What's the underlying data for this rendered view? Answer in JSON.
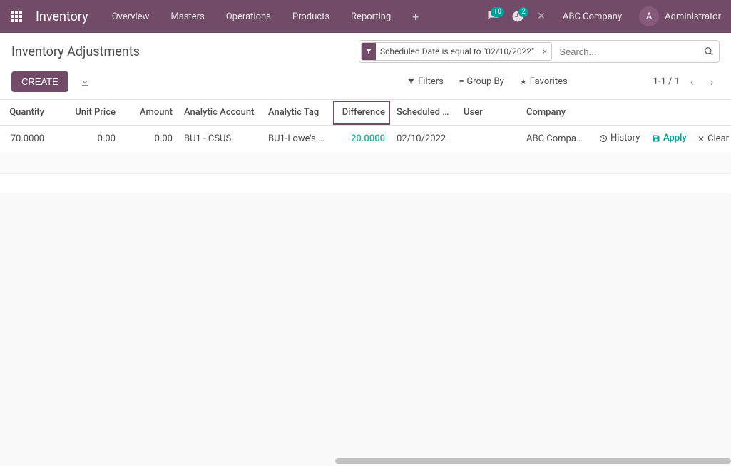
{
  "nav": {
    "brand": "Inventory",
    "items": [
      "Overview",
      "Masters",
      "Operations",
      "Products",
      "Reporting"
    ],
    "messages_badge": "10",
    "activities_badge": "2",
    "company": "ABC Company",
    "avatar_initial": "A",
    "user": "Administrator"
  },
  "cp": {
    "title": "Inventory Adjustments",
    "filter_facet": "Scheduled Date is equal to \"02/10/2022\"",
    "search_placeholder": "Search...",
    "create_label": "CREATE",
    "filters_label": "Filters",
    "groupby_label": "Group By",
    "favorites_label": "Favorites",
    "pager": "1-1 / 1"
  },
  "columns": {
    "quantity": "Quantity",
    "unit_price": "Unit Price",
    "amount": "Amount",
    "analytic_account": "Analytic Account",
    "analytic_tag": "Analytic Tag",
    "difference": "Difference",
    "scheduled": "Scheduled …",
    "user": "User",
    "company": "Company"
  },
  "row": {
    "quantity": "70.0000",
    "unit_price": "0.00",
    "amount": "0.00",
    "analytic_account": "BU1 - CSUS",
    "analytic_tag": "BU1-Lowe's …",
    "difference": "20.0000",
    "scheduled": "02/10/2022",
    "user": "",
    "company": "ABC Compa…"
  },
  "actions": {
    "history": "History",
    "apply": "Apply",
    "clear": "Clear"
  }
}
